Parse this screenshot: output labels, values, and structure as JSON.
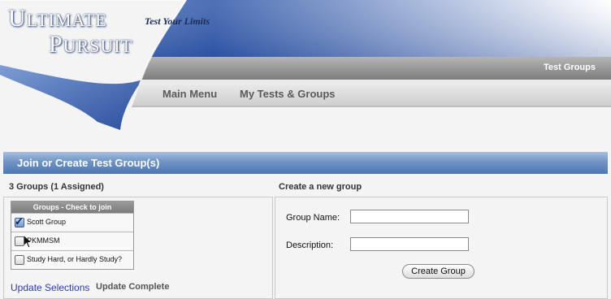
{
  "header": {
    "logo_line1": "Ultimate",
    "logo_line2": "Pursuit",
    "tagline": "Test Your Limits",
    "breadcrumb": "Test Groups",
    "colors": {
      "banner_blue": "#3b63b3",
      "breadcrumb_bar": "#9a9a9a"
    }
  },
  "nav": {
    "main_menu": "Main Menu",
    "my_tests": "My Tests & Groups"
  },
  "section": {
    "title": "Join or Create Test Group(s)",
    "bar_color": "#5a7fb8"
  },
  "groups": {
    "summary": "3 Groups (1 Assigned)",
    "table_header": "Groups - Check to join",
    "items": [
      {
        "label": "Scott Group",
        "checked": true
      },
      {
        "label": "PKMMSM",
        "checked": false
      },
      {
        "label": "Study Hard, or Hardly Study?",
        "checked": false
      }
    ],
    "update_link": "Update Selections",
    "update_status": "Update Complete"
  },
  "create": {
    "heading": "Create a new group",
    "name_label": "Group Name:",
    "name_value": "",
    "description_label": "Description:",
    "description_value": "",
    "button_label": "Create Group"
  }
}
